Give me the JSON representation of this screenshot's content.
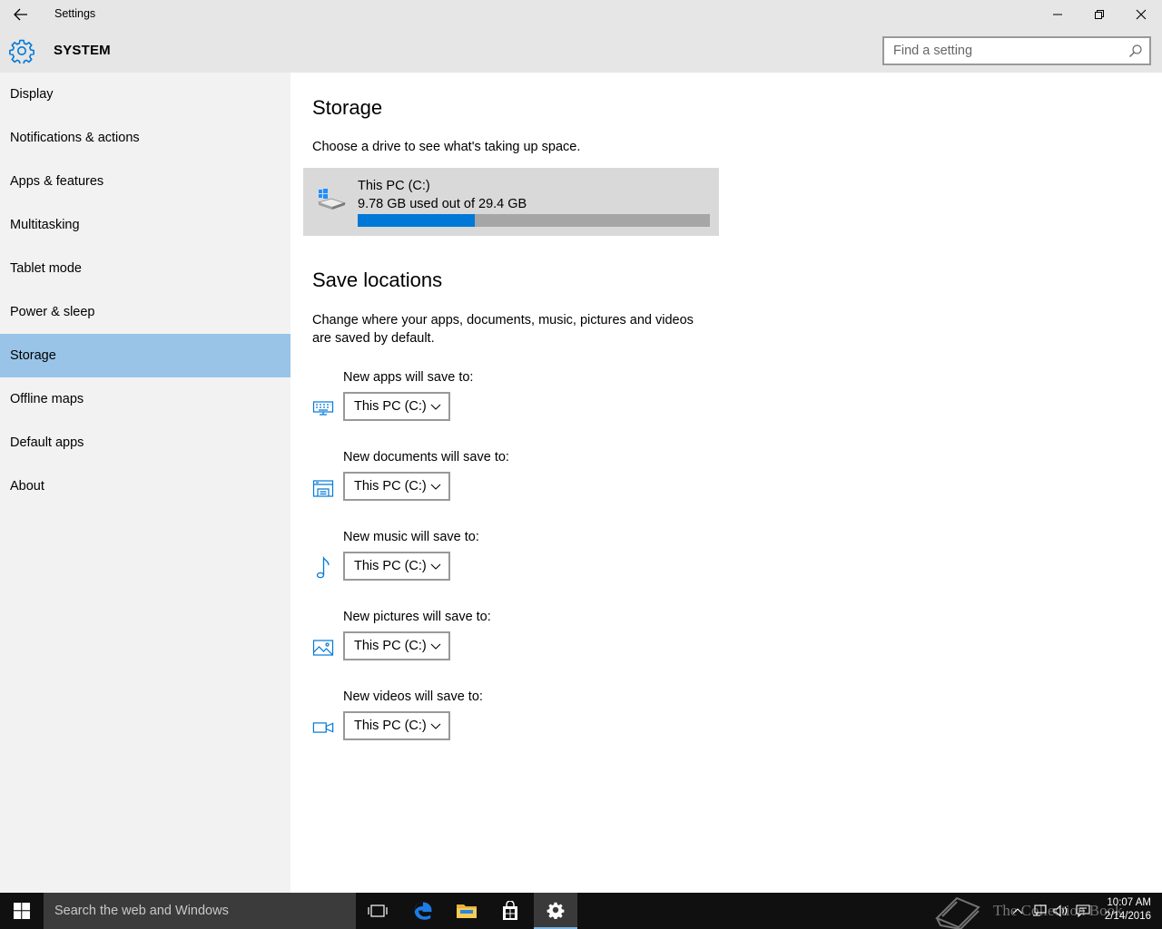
{
  "window": {
    "title": "Settings",
    "section": "SYSTEM",
    "search_placeholder": "Find a setting"
  },
  "sidebar": {
    "items": [
      {
        "label": "Display"
      },
      {
        "label": "Notifications & actions"
      },
      {
        "label": "Apps & features"
      },
      {
        "label": "Multitasking"
      },
      {
        "label": "Tablet mode"
      },
      {
        "label": "Power & sleep"
      },
      {
        "label": "Storage",
        "active": true
      },
      {
        "label": "Offline maps"
      },
      {
        "label": "Default apps"
      },
      {
        "label": "About"
      }
    ]
  },
  "storage": {
    "title": "Storage",
    "description": "Choose a drive to see what's taking up space.",
    "drive": {
      "name": "This PC (C:)",
      "usage_text": "9.78 GB used out of 29.4 GB",
      "used_fraction": 0.333
    }
  },
  "save_locations": {
    "title": "Save locations",
    "description": "Change where your apps, documents, music, pictures and videos are saved by default.",
    "groups": [
      {
        "label": "New apps will save to:",
        "value": "This PC (C:)",
        "icon": "apps-keyboard-icon"
      },
      {
        "label": "New documents will save to:",
        "value": "This PC (C:)",
        "icon": "documents-icon"
      },
      {
        "label": "New music will save to:",
        "value": "This PC (C:)",
        "icon": "music-note-icon"
      },
      {
        "label": "New pictures will save to:",
        "value": "This PC (C:)",
        "icon": "pictures-icon"
      },
      {
        "label": "New videos will save to:",
        "value": "This PC (C:)",
        "icon": "video-camera-icon"
      }
    ]
  },
  "taskbar": {
    "search_placeholder": "Search the web and Windows",
    "time": "10:07 AM",
    "date": "2/14/2016",
    "watermark": "The Collection Book"
  },
  "colors": {
    "accent": "#0078d7",
    "nav_active": "#99c4e8",
    "chrome": "#e6e6e6",
    "sidebar": "#f2f2f2",
    "taskbar": "#101010"
  }
}
